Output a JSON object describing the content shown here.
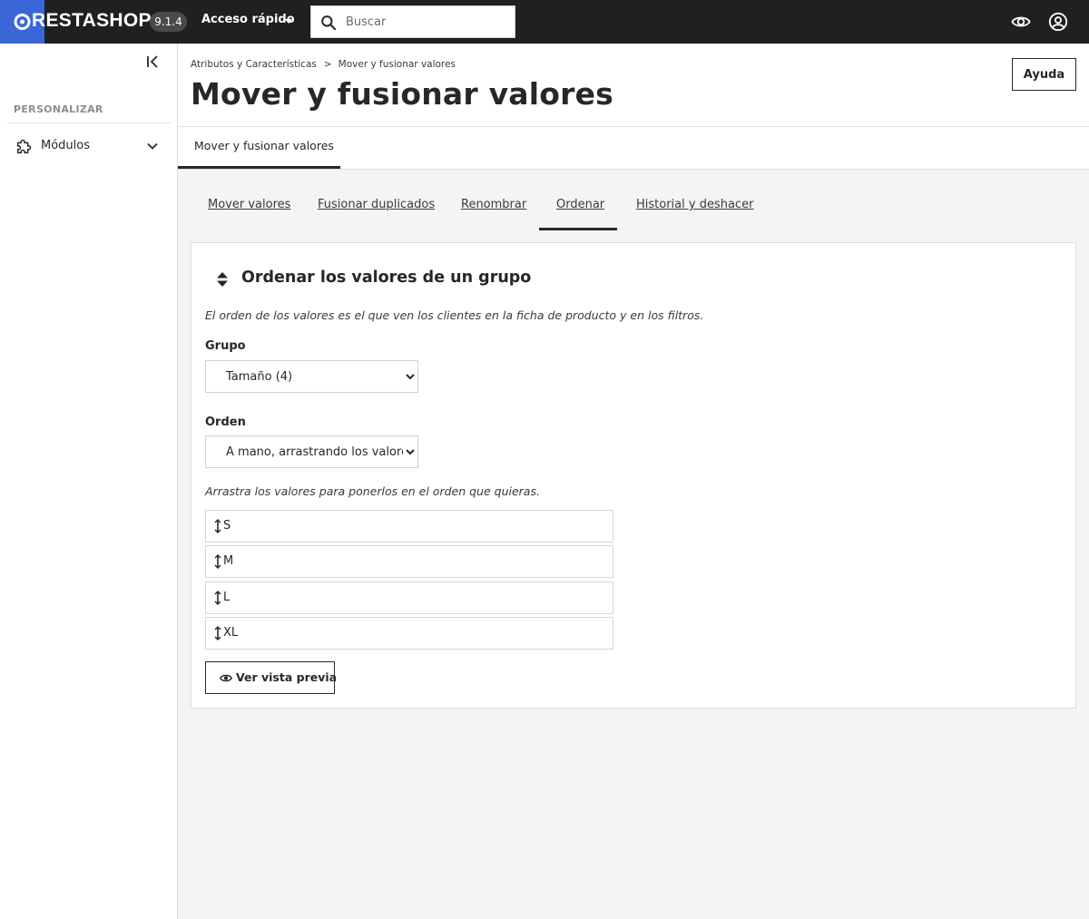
{
  "header": {
    "logo_text": "RESTASHOP",
    "version": "9.1.4",
    "quick_access_label": "Acceso rápido",
    "search_placeholder": "Buscar",
    "brand_color": "#3a66d8",
    "bar_color": "#202022"
  },
  "sidebar": {
    "section_title": "PERSONALIZAR",
    "items": [
      {
        "label": "Módulos",
        "icon": "puzzle-icon",
        "expanded": false
      }
    ]
  },
  "breadcrumb": {
    "parent": "Atributos y Características",
    "separator": ">",
    "current": "Mover y fusionar valores"
  },
  "page": {
    "title": "Mover y fusionar valores",
    "help_label": "Ayuda",
    "top_tab": "Mover y fusionar valores"
  },
  "subtabs": {
    "items": [
      "Mover valores",
      "Fusionar duplicados",
      "Renombrar",
      "Ordenar",
      "Historial y deshacer"
    ],
    "active": "Ordenar"
  },
  "card": {
    "icon": "sort-icon",
    "title": "Ordenar los valores de un grupo",
    "description": "El orden de los valores es el que ven los clientes en la ficha de producto y en los filtros.",
    "group_label": "Grupo",
    "group_value": "Tamaño (4)",
    "order_label": "Orden",
    "order_value": "A mano, arrastrando los valores",
    "drag_hint": "Arrastra los valores para ponerlos en el orden que quieras.",
    "values": [
      "S",
      "M",
      "L",
      "XL"
    ],
    "preview_label": "Ver vista previa"
  }
}
